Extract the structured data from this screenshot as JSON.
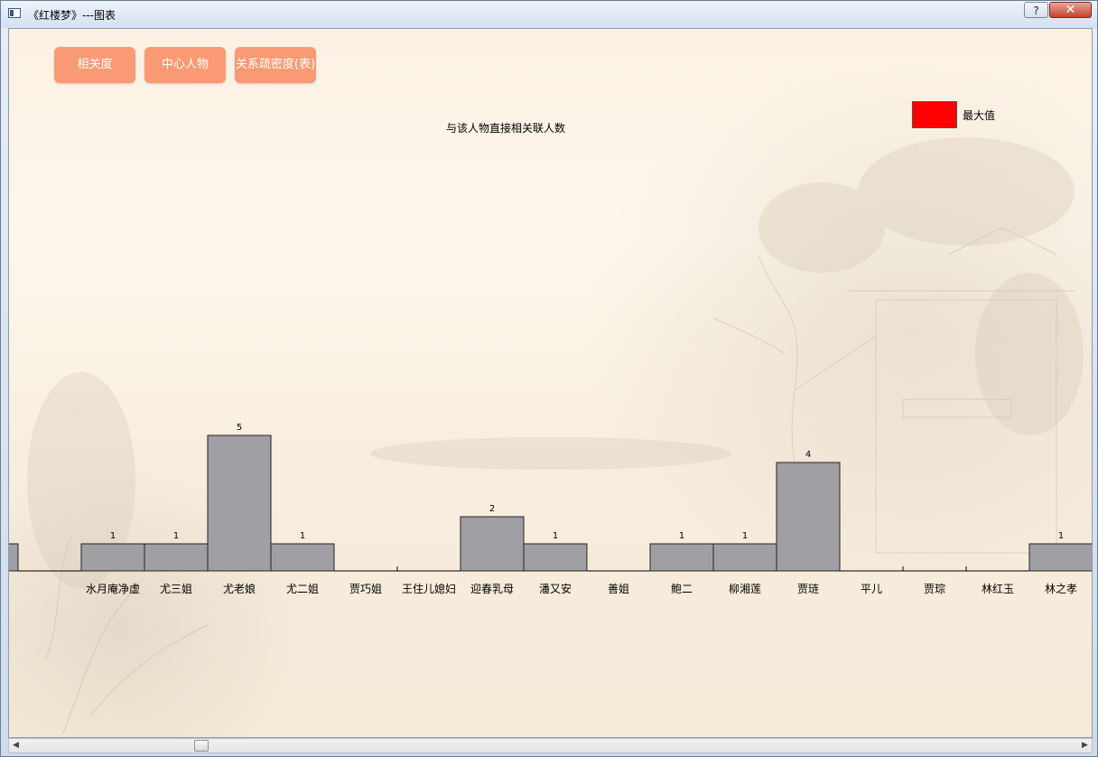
{
  "window": {
    "title": "《红楼梦》---图表",
    "help_label": "?",
    "close_label": "✕"
  },
  "toolbar": {
    "buttons": [
      {
        "label": "相关度"
      },
      {
        "label": "中心人物"
      },
      {
        "label": "关系疏密度(表)"
      }
    ]
  },
  "legend": {
    "label": "最大值",
    "color": "#ff0000"
  },
  "chart_data": {
    "type": "bar",
    "title": "与该人物直接相关联人数",
    "xlabel": "",
    "ylabel": "",
    "categories": [
      "",
      "",
      "水月庵净虚",
      "尤三姐",
      "尤老娘",
      "尤二姐",
      "贾巧姐",
      "王住儿媳妇",
      "迎春乳母",
      "潘又安",
      "善姐",
      "鲍二",
      "柳湘莲",
      "贾琏",
      "平儿",
      "贾琮",
      "林红玉",
      "林之孝"
    ],
    "values": [
      1,
      0,
      1,
      1,
      5,
      1,
      0,
      0,
      2,
      1,
      0,
      1,
      1,
      4,
      0,
      0,
      0,
      1
    ],
    "value_labels": [
      "",
      "",
      "1",
      "1",
      "5",
      "1",
      "",
      "",
      "2",
      "1",
      "",
      "1",
      "1",
      "4",
      "",
      "",
      "",
      "1"
    ],
    "bar_color": "#a09fa4",
    "grid": false,
    "legend_position": "top-right"
  },
  "scrollbar": {
    "left_arrow": "◀",
    "right_arrow": "▶"
  }
}
